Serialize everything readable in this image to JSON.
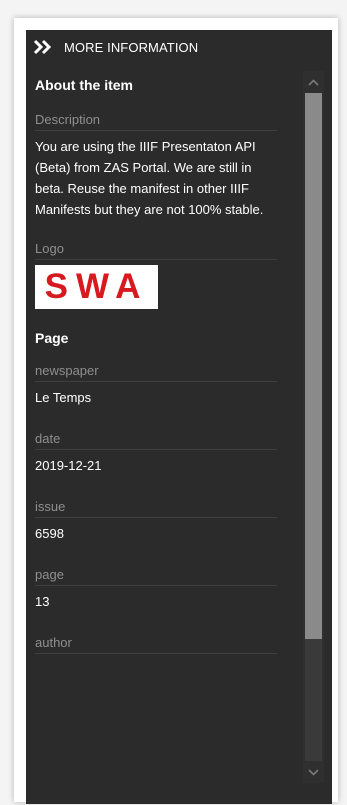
{
  "panel": {
    "header_title": "MORE INFORMATION",
    "sections": [
      {
        "title": "About the item",
        "fields": [
          {
            "label": "Description",
            "value": "You are using the IIIF Presentaton API (Beta) from ZAS Portal. We are still in beta. Reuse the manifest in other IIIF Manifests but they are not 100% stable."
          },
          {
            "label": "Logo",
            "logo_text": "SWA"
          }
        ]
      },
      {
        "title": "Page",
        "fields": [
          {
            "label": "newspaper",
            "value": "Le Temps"
          },
          {
            "label": "date",
            "value": "2019-12-21"
          },
          {
            "label": "issue",
            "value": "6598"
          },
          {
            "label": "page",
            "value": "13"
          },
          {
            "label": "author",
            "value": ""
          }
        ]
      }
    ]
  },
  "icons": {
    "header": "double-chevron-right-icon",
    "scroll_up": "chevron-up-icon",
    "scroll_down": "chevron-down-icon"
  },
  "colors": {
    "panel_bg": "#2b2b2b",
    "label": "#8f8f8f",
    "text": "#ffffff",
    "logo_red": "#d71920"
  }
}
